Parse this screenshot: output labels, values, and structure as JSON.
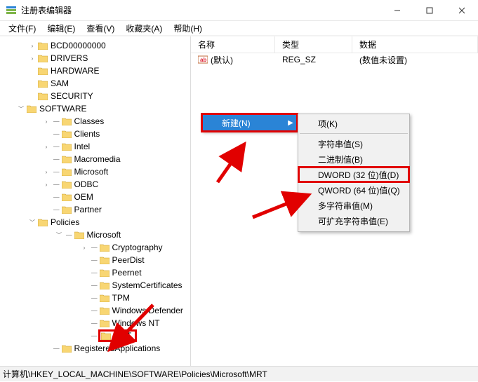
{
  "window": {
    "title": "注册表编辑器"
  },
  "menus": {
    "file": "文件(F)",
    "edit": "编辑(E)",
    "view": "查看(V)",
    "favorites": "收藏夹(A)",
    "help": "帮助(H)"
  },
  "tree": {
    "items": [
      {
        "indent": 2,
        "exp": "closed",
        "label": "BCD00000000"
      },
      {
        "indent": 2,
        "exp": "closed",
        "label": "DRIVERS"
      },
      {
        "indent": 2,
        "exp": "none",
        "label": "HARDWARE"
      },
      {
        "indent": 2,
        "exp": "none",
        "label": "SAM"
      },
      {
        "indent": 2,
        "exp": "none",
        "label": "SECURITY"
      },
      {
        "indent": 1,
        "exp": "open",
        "label": "SOFTWARE"
      },
      {
        "indent": 3,
        "exp": "closed",
        "label": "Classes"
      },
      {
        "indent": 3,
        "exp": "none",
        "label": "Clients"
      },
      {
        "indent": 3,
        "exp": "closed",
        "label": "Intel"
      },
      {
        "indent": 3,
        "exp": "none",
        "label": "Macromedia"
      },
      {
        "indent": 3,
        "exp": "closed",
        "label": "Microsoft"
      },
      {
        "indent": 3,
        "exp": "closed",
        "label": "ODBC"
      },
      {
        "indent": 3,
        "exp": "none",
        "label": "OEM"
      },
      {
        "indent": 3,
        "exp": "none",
        "label": "Partner"
      },
      {
        "indent": 2,
        "exp": "open",
        "label": "Policies"
      },
      {
        "indent": 4,
        "exp": "open",
        "label": "Microsoft"
      },
      {
        "indent": 6,
        "exp": "closed",
        "label": "Cryptography"
      },
      {
        "indent": 6,
        "exp": "none",
        "label": "PeerDist"
      },
      {
        "indent": 6,
        "exp": "none",
        "label": "Peernet"
      },
      {
        "indent": 6,
        "exp": "none",
        "label": "SystemCertificates"
      },
      {
        "indent": 6,
        "exp": "none",
        "label": "TPM"
      },
      {
        "indent": 6,
        "exp": "none",
        "label": "Windows Defender"
      },
      {
        "indent": 6,
        "exp": "none",
        "label": "Windows NT"
      },
      {
        "indent": 6,
        "exp": "none",
        "label": "MRT",
        "hl": true
      },
      {
        "indent": 3,
        "exp": "none",
        "label": "RegisteredApplications"
      }
    ]
  },
  "list": {
    "headers": {
      "name": "名称",
      "type": "类型",
      "data": "数据"
    },
    "rows": [
      {
        "name": "(默认)",
        "type": "REG_SZ",
        "data": "(数值未设置)"
      }
    ]
  },
  "context1": {
    "new": "新建(N)"
  },
  "context2": {
    "key": "项(K)",
    "string": "字符串值(S)",
    "binary": "二进制值(B)",
    "dword": "DWORD (32 位)值(D)",
    "qword": "QWORD (64 位)值(Q)",
    "multi": "多字符串值(M)",
    "expand": "可扩充字符串值(E)"
  },
  "status": {
    "path": "计算机\\HKEY_LOCAL_MACHINE\\SOFTWARE\\Policies\\Microsoft\\MRT"
  }
}
